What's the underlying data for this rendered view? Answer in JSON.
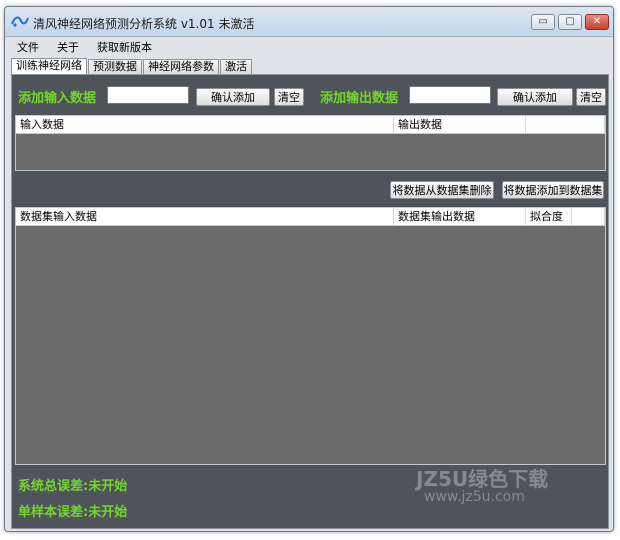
{
  "window": {
    "title": "清风神经网络预测分析系统 v1.01 未激活",
    "controls": {
      "minimize": "▭",
      "maximize": "▢",
      "close": "✕"
    }
  },
  "menu": {
    "items": [
      {
        "label": "文件"
      },
      {
        "label": "关于"
      },
      {
        "label": "获取新版本"
      }
    ]
  },
  "tabs": [
    {
      "label": "训练神经网络",
      "active": true
    },
    {
      "label": "预测数据",
      "active": false
    },
    {
      "label": "神经网络参数",
      "active": false
    },
    {
      "label": "激活",
      "active": false
    }
  ],
  "input_section": {
    "title": "添加输入数据",
    "value": "",
    "confirm_label": "确认添加",
    "clear_label": "清空"
  },
  "output_section": {
    "title": "添加输出数据",
    "value": "",
    "confirm_label": "确认添加",
    "clear_label": "清空"
  },
  "pending_grid": {
    "columns": [
      "输入数据",
      "输出数据",
      ""
    ]
  },
  "actions": {
    "remove_label": "将数据从数据集删除",
    "add_label": "将数据添加到数据集"
  },
  "dataset_grid": {
    "columns": [
      "数据集输入数据",
      "数据集输出数据",
      "拟合度",
      ""
    ]
  },
  "status": {
    "total_error_label": "系统总误差:",
    "total_error_value": "未开始",
    "single_error_label": "单样本误差:",
    "single_error_value": "未开始"
  },
  "watermark": {
    "line1": "JZ5U绿色下载",
    "line2": "www.jz5u.com"
  },
  "colors": {
    "accent_green": "#74d62c",
    "panel_bg": "#4e5459",
    "grid_bg": "#6b6b6b"
  }
}
